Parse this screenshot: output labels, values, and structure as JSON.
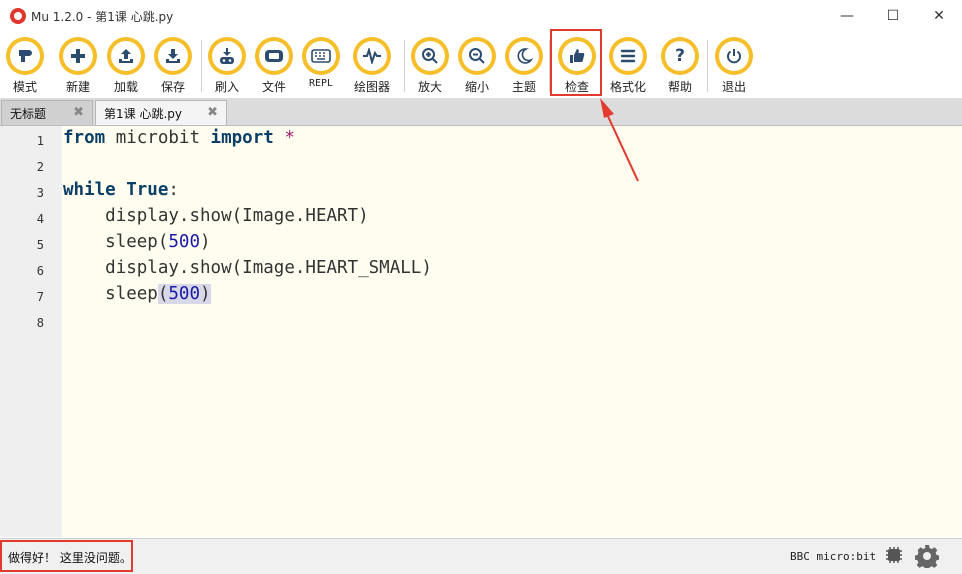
{
  "window": {
    "title": "Mu 1.2.0 - 第1课 心跳.py",
    "minimize": "—",
    "maximize": "☐",
    "close": "✕"
  },
  "toolbar": [
    {
      "id": "mode",
      "label": "模式",
      "icon": "mode-icon"
    },
    {
      "id": "new",
      "label": "新建",
      "icon": "plus-icon"
    },
    {
      "id": "load",
      "label": "加载",
      "icon": "upload-icon"
    },
    {
      "id": "save",
      "label": "保存",
      "icon": "download-icon"
    },
    {
      "id": "flash",
      "label": "刷入",
      "icon": "flash-icon"
    },
    {
      "id": "files",
      "label": "文件",
      "icon": "files-icon"
    },
    {
      "id": "repl",
      "label": "REPL",
      "icon": "keyboard-icon"
    },
    {
      "id": "plotter",
      "label": "绘图器",
      "icon": "pulse-icon"
    },
    {
      "id": "zoom_in",
      "label": "放大",
      "icon": "zoom-in-icon"
    },
    {
      "id": "zoom_out",
      "label": "缩小",
      "icon": "zoom-out-icon"
    },
    {
      "id": "theme",
      "label": "主题",
      "icon": "moon-icon"
    },
    {
      "id": "check",
      "label": "检查",
      "icon": "thumbs-up-icon"
    },
    {
      "id": "tidy",
      "label": "格式化",
      "icon": "list-icon"
    },
    {
      "id": "help",
      "label": "帮助",
      "icon": "question-icon"
    },
    {
      "id": "quit",
      "label": "退出",
      "icon": "power-icon"
    }
  ],
  "tabs": [
    {
      "label": "无标题",
      "close": "✖"
    },
    {
      "label": "第1课 心跳.py",
      "close": "✖"
    }
  ],
  "editor": {
    "line_numbers": [
      "1",
      "2",
      "3",
      "4",
      "5",
      "6",
      "7",
      "8"
    ],
    "lines": [
      "from microbit import *",
      "",
      "while True:",
      "    display.show(Image.HEART)",
      "    sleep(500)",
      "    display.show(Image.HEART_SMALL)",
      "    sleep(500)",
      ""
    ]
  },
  "status": {
    "message": "做得好！ 这里没问题。",
    "device": "BBC micro:bit"
  },
  "colors": {
    "accent": "#f6bf29",
    "highlight": "#e23a2e",
    "editor_bg": "#fefdf0"
  }
}
